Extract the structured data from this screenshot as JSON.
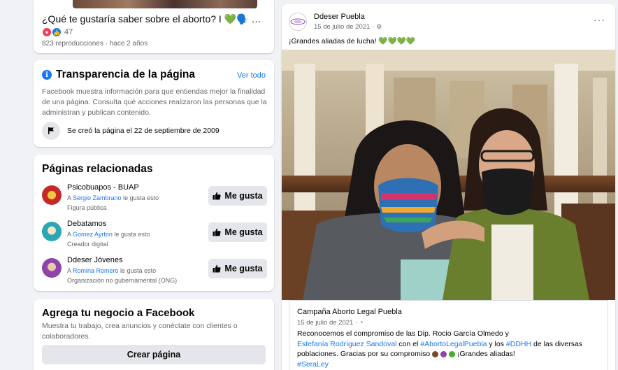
{
  "video_card": {
    "title": "¿Qué te gustaría saber sobre el aborto? I 💚🗣️ Esta solo ...",
    "reaction_count": "47",
    "meta": "823 reproducciones · hace 2 años"
  },
  "transparency": {
    "title": "Transparencia de la página",
    "see_all": "Ver todo",
    "description": "Facebook muestra información para que entiendas mejor la finalidad de una página. Consulta qué acciones realizaron las personas que la administran y publican contenido.",
    "created": "Se creó la página el 22 de septiembre de 2009"
  },
  "related": {
    "title": "Páginas relacionadas",
    "like_label": "Me gusta",
    "items": [
      {
        "name": "Psicobuapos - BUAP",
        "prefix": "A ",
        "friend": "Sergio Zambrano",
        "suffix": " le gusta esto",
        "category": "Figura pública"
      },
      {
        "name": "Debatamos",
        "prefix": "A ",
        "friend": "Gomez Ayrton",
        "suffix": " le gusta esto",
        "category": "Creador digital"
      },
      {
        "name": "Ddeser Jóvenes",
        "prefix": "A ",
        "friend": "Romina Romero",
        "suffix": " le gusta esto",
        "category": "Organización no gubernamental (ONG)"
      }
    ]
  },
  "business": {
    "title": "Agrega tu negocio a Facebook",
    "description": "Muestra tu trabajo, crea anuncios y conéctate con clientes o colaboradores.",
    "button": "Crear página"
  },
  "post": {
    "page_name": "Ddeser Puebla",
    "date": "15 de julio de 2021 ·",
    "more": "···",
    "caption": "¡Grandes aliadas de lucha! 💚💚💚💚",
    "shared": {
      "name": "Campaña Aborto Legal Puebla",
      "date": "15 de julio de 2021 ·",
      "line1": "Reconocemos el compromiso de las Dip. Rocio García Olmedo y",
      "link1": "Estefanía Rodríguez Sandoval",
      "mid1": " con el ",
      "link2": "#AbortoLegalPuebla",
      "mid2": " y los ",
      "link3": "#DDHH",
      "mid3": " de las diversas",
      "line3": "poblaciones.  Gracias por su compromiso",
      "line3_end": " ¡Grandes aliadas!",
      "hashtag": "#SeraLey"
    }
  },
  "colors": {
    "accent": "#1877f2",
    "background": "#f0f2f5",
    "secondary_text": "#65676b"
  }
}
